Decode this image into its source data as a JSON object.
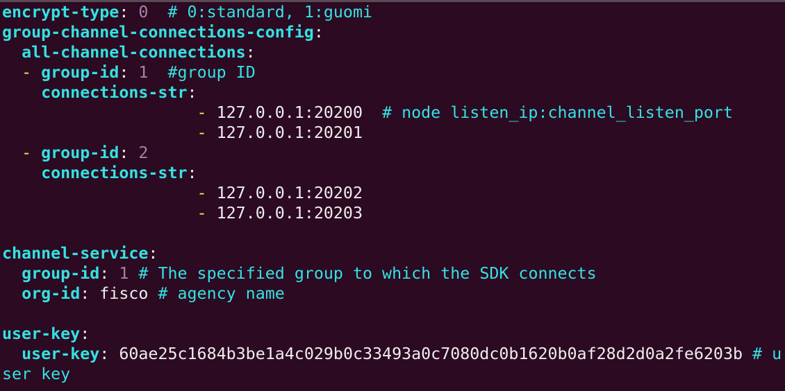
{
  "colors": {
    "background": "#2c0a22",
    "key": "#34e2e2",
    "comment": "#34e2e2",
    "number": "#ad7fa8",
    "dash": "#fce94f",
    "text": "#eeeeec"
  },
  "encrypt_type": {
    "key": "encrypt-type",
    "value": "0",
    "comment": "# 0:standard, 1:guomi"
  },
  "group_channel": {
    "key": "group-channel-connections-config",
    "all_key": "all-channel-connections",
    "groups": [
      {
        "group_id_key": "group-id",
        "group_id": "1",
        "group_comment": "#group ID",
        "conn_key": "connections-str",
        "connections": [
          {
            "dash": "-",
            "addr": "127.0.0.1:20200",
            "comment": "# node listen_ip:channel_listen_port"
          },
          {
            "dash": "-",
            "addr": "127.0.0.1:20201",
            "comment": ""
          }
        ]
      },
      {
        "group_id_key": "group-id",
        "group_id": "2",
        "group_comment": "",
        "conn_key": "connections-str",
        "connections": [
          {
            "dash": "-",
            "addr": "127.0.0.1:20202",
            "comment": ""
          },
          {
            "dash": "-",
            "addr": "127.0.0.1:20203",
            "comment": ""
          }
        ]
      }
    ]
  },
  "channel_service": {
    "key": "channel-service",
    "group_id_key": "group-id",
    "group_id": "1",
    "group_comment": "# The specified group to which the SDK connects",
    "org_id_key": "org-id",
    "org_id": "fisco",
    "org_comment": "# agency name"
  },
  "user_key": {
    "key": "user-key",
    "inner_key": "user-key",
    "value": "60ae25c1684b3be1a4c029b0c33493a0c7080dc0b1620b0af28d2d0a2fe6203b",
    "comment_part1": "# u",
    "comment_part2": "ser key"
  }
}
